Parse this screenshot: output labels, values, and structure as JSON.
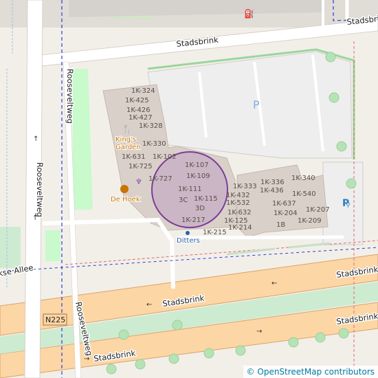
{
  "map": {
    "streets": {
      "stadsbrink_north": "Stadsbrink",
      "stadsbrink_ne": "Stadsbrink",
      "stadsbrink_mid": "Stadsbrink",
      "stadsbrink_right": "Stadsbrink",
      "stadsbrink_lower": "Stadsbrink",
      "stadsbrink_lower_right": "Stadsbrink",
      "rooseveltweg_left": "Rooseveltweg",
      "rooseveltweg_top": "Rooseveltweg",
      "rooseveltweg_bottom": "Rooseveltweg",
      "allee_partial": "kse Allee"
    },
    "route_shield": "N225",
    "pois": {
      "kings_garden": "King's\nGarden",
      "de_hoek": "De Hoek",
      "ditters": "Ditters"
    },
    "parking_symbol": "P",
    "house_numbers": [
      "1K-324",
      "1K-425",
      "1K-426",
      "1K-427",
      "1K-328",
      "1K-330",
      "1K-631",
      "1K-102",
      "1K-725",
      "1K-727",
      "1K-107",
      "1K-109",
      "1K-111",
      "3C",
      "1K-115",
      "3D",
      "1K-217",
      "1K-215",
      "1K-333",
      "1K-432",
      "1K-532",
      "1K-632",
      "1K-125",
      "1K-214",
      "1K-336",
      "1K-436",
      "1K-340",
      "1K-540",
      "1K-637",
      "1K-204",
      "1K-207",
      "1K-209",
      "1B"
    ],
    "colors": {
      "background": "#f2efe9",
      "building": "#d9d0c9",
      "parking": "#eeeeee",
      "main_road": "#fcd6a4",
      "green": "#c8facc",
      "highlight_circle": "#9b59b6"
    }
  },
  "attribution": {
    "symbol": "©",
    "text": "OpenStreetMap contributors"
  }
}
